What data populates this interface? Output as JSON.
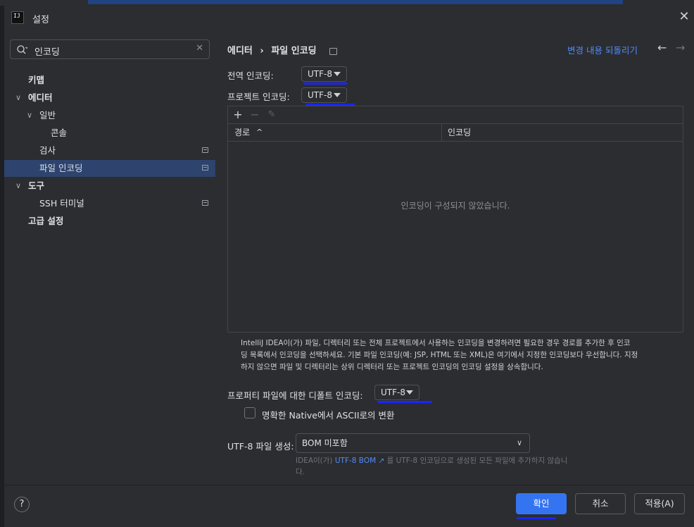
{
  "window": {
    "title": "설정",
    "app_icon_text": "IJ"
  },
  "sidebar": {
    "search_value": "인코딩",
    "items": [
      {
        "label": "키맵"
      },
      {
        "label": "에디터"
      },
      {
        "label": "일반"
      },
      {
        "label": "콘솔"
      },
      {
        "label": "검사"
      },
      {
        "label": "파일 인코딩"
      },
      {
        "label": "도구"
      },
      {
        "label": "SSH 터미널"
      },
      {
        "label": "고급 설정"
      }
    ]
  },
  "breadcrumb": {
    "parent": "에디터",
    "separator": "›",
    "current": "파일 인코딩"
  },
  "header": {
    "reset_link": "변경 내용 되돌리기",
    "back_icon": "←",
    "forward_icon": "→"
  },
  "encoding": {
    "global_label": "전역 인코딩:",
    "global_value": "UTF-8",
    "project_label": "프로젝트 인코딩:",
    "project_value": "UTF-8"
  },
  "table": {
    "toolbar": {
      "add": "+",
      "remove": "−",
      "edit": "✎"
    },
    "col_path": "경로",
    "sort_indicator": "^",
    "col_encoding": "인코딩",
    "empty_message": "인코딩이 구성되지 않았습니다."
  },
  "description_lines": [
    "IntelliJ IDEA이(가) 파일, 디렉터리 또는 전체 프로젝트에서 사용하는 인코딩을 변경하려면 필요한 경우 경로를 추가한 후 인코",
    "딩 목록에서 인코딩을 선택하세요. 기본 파일 인코딩(예: JSP, HTML 또는 XML)은 여기에서 지정한 인코딩보다 우선합니다. 지정",
    "하지 않으면 파일 및 디렉터리는 상위 디렉터리 또는 프로젝트 인코딩의 인코딩 설정을 상속합니다."
  ],
  "properties": {
    "label": "프로퍼티 파일에 대한 디폴트 인코딩:",
    "value": "UTF-8",
    "native_checkbox_label": "명확한 Native에서 ASCII로의 변환",
    "native_checked": false
  },
  "bom": {
    "label": "UTF-8 파일 생성:",
    "value": "BOM 미포함",
    "hint_prefix": "IDEA이(가) ",
    "hint_link": "UTF-8 BOM ↗",
    "hint_suffix": " 를 UTF-8 인코딩으로 생성된 모든 파일에 추가하지 않습니",
    "hint_line2": "다."
  },
  "footer": {
    "help": "?",
    "ok": "확인",
    "cancel": "취소",
    "apply": "적용(A)"
  },
  "colors": {
    "accent": "#3574f0",
    "link": "#548af7",
    "selection": "#2e436e",
    "annotation_underline": "#1a25ff",
    "background": "#2b2d30"
  }
}
